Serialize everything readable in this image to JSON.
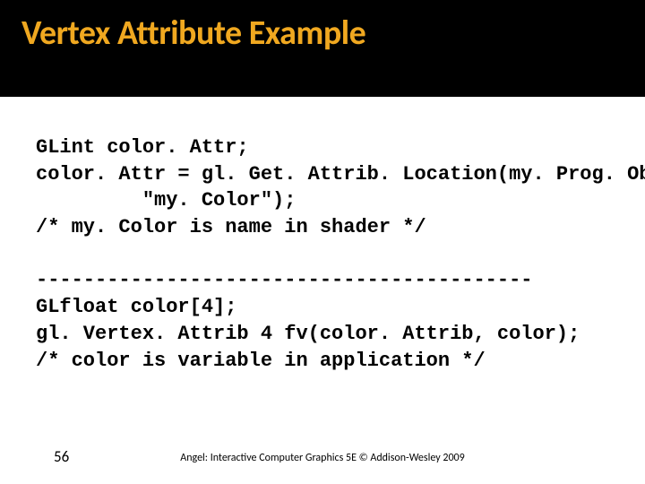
{
  "title": "Vertex Attribute Example",
  "code": {
    "l1": "GLint color. Attr;",
    "l2": "color. Attr = gl. Get. Attrib. Location(my. Prog. Obj,",
    "l3": "         \"my. Color\");",
    "l4": "/* my. Color is name in shader */",
    "l5": "",
    "l6": "------------------------------------------",
    "l7": "GLfloat color[4];",
    "l8": "gl. Vertex. Attrib 4 fv(color. Attrib, color);",
    "l9": "/* color is variable in application */"
  },
  "footer": {
    "page": "56",
    "copyright": "Angel: Interactive Computer Graphics 5E © Addison-Wesley 2009"
  }
}
